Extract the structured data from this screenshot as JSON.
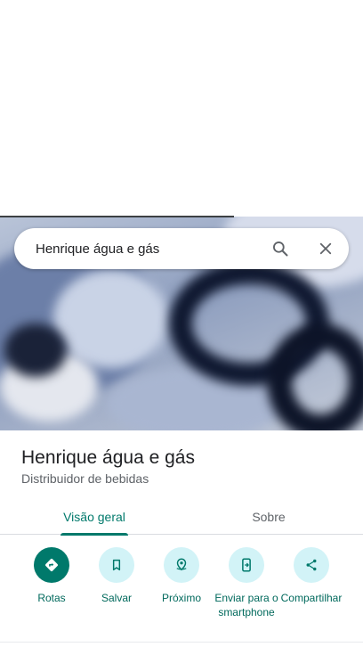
{
  "search": {
    "query": "Henrique água e gás"
  },
  "place": {
    "name": "Henrique água e gás",
    "category": "Distribuidor de bebidas"
  },
  "tabs": [
    {
      "label": "Visão geral",
      "active": true
    },
    {
      "label": "Sobre",
      "active": false
    }
  ],
  "actions": [
    {
      "label": "Rotas",
      "icon": "directions-icon"
    },
    {
      "label": "Salvar",
      "icon": "bookmark-icon"
    },
    {
      "label": "Próximo",
      "icon": "nearby-icon"
    },
    {
      "label": "Enviar para o smartphone",
      "icon": "send-to-phone-icon"
    },
    {
      "label": "Compartilhar",
      "icon": "share-icon"
    }
  ],
  "colors": {
    "accent": "#00796b",
    "action_bg": "#d2f3f7",
    "text_primary": "#202124",
    "text_secondary": "#5f6368"
  }
}
